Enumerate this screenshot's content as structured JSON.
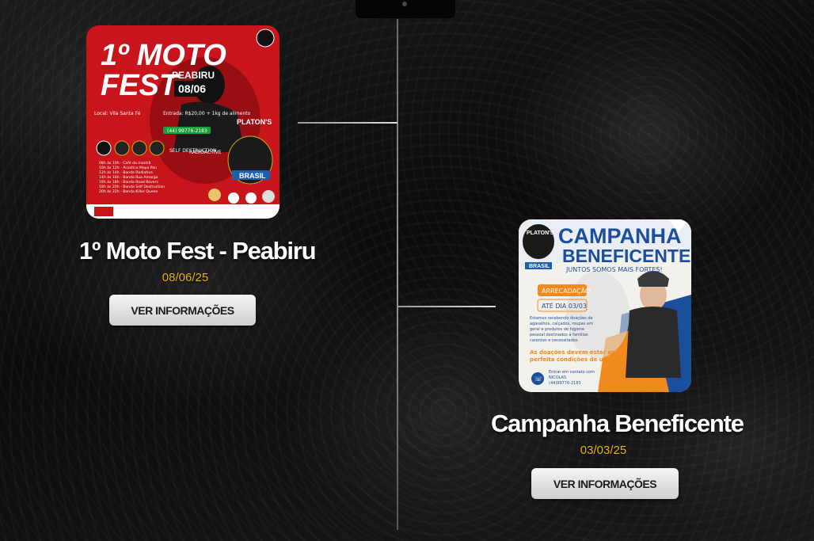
{
  "events": [
    {
      "title": "1º  Moto Fest - Peabiru",
      "date": "08/06/25",
      "button_label": "VER INFORMAÇÕES",
      "poster": {
        "line1": "1º MOTO",
        "line2": "FEST",
        "location_tag": "PEABIRU",
        "date_tag": "08/06",
        "badge": "PLATON'S",
        "badge_sub": "BRASIL",
        "info_left": "Local: Vila Santa Fé",
        "info_right": "Entrada: R$20,00 + 1kg de alimento",
        "phone": "(44) 99776-2183",
        "sponsor_a": "SELF DESTRUCTION",
        "sponsor_b": "RADIOACTIVE",
        "schedule": [
          "08h às 10h - Café da manhã",
          "10h às 12h - Acústico Maya Pan",
          "12h às 14h - Banda Radiativa",
          "14h às 16h - Banda Rua Amarga",
          "16h às 18h - Banda Road Rovers",
          "18h às 20h - Banda Self Destruction",
          "20h às 22h - Banda Killer Queen"
        ]
      }
    },
    {
      "title": "Campanha Beneficente",
      "date": "03/03/25",
      "button_label": "VER INFORMAÇÕES",
      "poster": {
        "badge": "PLATON'S",
        "badge_sub": "BRASIL",
        "heading": "CAMPANHA",
        "subheading": "BENEFICENTE",
        "tagline": "JUNTOS SOMOS MAIS FORTES!",
        "tag1": "ARRECADAÇÃO",
        "tag2": "ATÉ DIA 03/03",
        "body": [
          "Estamos recebendo doações de",
          "agasalhos, calçados, roupas em",
          "geral e produtos de higiene",
          "pessoal destinados a famílias",
          "carentes e necessitados."
        ],
        "notice": [
          "As doações devem estar em",
          "perfeita condições de uso !"
        ],
        "contact": [
          "Entrar em contato com",
          "NICOLAS",
          "(44)99776-2183"
        ]
      }
    }
  ],
  "colors": {
    "date": "#e8b400",
    "poster1_red": "#c8141b",
    "poster2_blue": "#1b4f9c",
    "poster2_orange": "#f08a1c"
  }
}
